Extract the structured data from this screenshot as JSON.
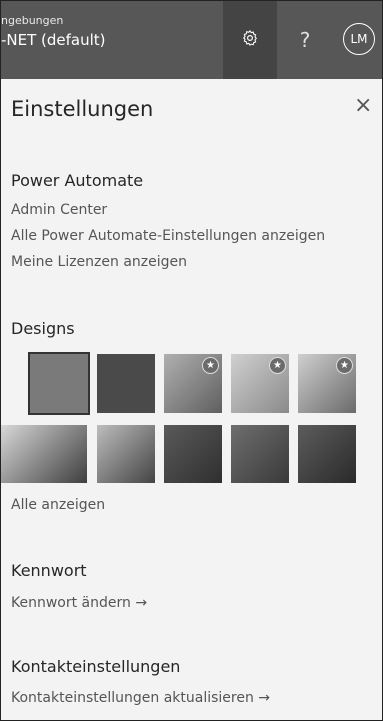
{
  "header": {
    "env_label": "ngebungen",
    "env_name": "-NET (default)",
    "help_glyph": "?",
    "avatar_initials": "LM"
  },
  "panel": {
    "title": "Einstellungen",
    "close_glyph": "×"
  },
  "power_automate": {
    "title": "Power Automate",
    "links": [
      "Admin Center",
      "Alle Power Automate-Einstellungen anzeigen",
      "Meine Lizenzen anzeigen"
    ]
  },
  "designs": {
    "title": "Designs",
    "show_all": "Alle anzeigen",
    "thumbnails": [
      {
        "name": "design-solid-gray",
        "starred": false,
        "colors": [
          "#7a7a7a",
          "#7a7a7a"
        ]
      },
      {
        "name": "design-solid-dark",
        "starred": false,
        "colors": [
          "#4a4a4a",
          "#4a4a4a"
        ]
      },
      {
        "name": "design-waves",
        "starred": true,
        "colors": [
          "#b0b0b0",
          "#5f5f5f"
        ]
      },
      {
        "name": "design-ribbons",
        "starred": true,
        "colors": [
          "#d0d0d0",
          "#8a8a8a"
        ]
      },
      {
        "name": "design-flowers",
        "starred": true,
        "colors": [
          "#cfcfcf",
          "#6a6a6a"
        ]
      },
      {
        "name": "design-hills",
        "starred": false,
        "colors": [
          "#d9d9d9",
          "#3e3e3e"
        ]
      },
      {
        "name": "design-palms",
        "starred": false,
        "colors": [
          "#bdbdbd",
          "#444444"
        ]
      },
      {
        "name": "design-circuit",
        "starred": false,
        "colors": [
          "#5a5a5a",
          "#2f2f2f"
        ]
      },
      {
        "name": "design-aviation",
        "starred": false,
        "colors": [
          "#6e6e6e",
          "#3a3a3a"
        ]
      },
      {
        "name": "design-bokeh",
        "starred": false,
        "colors": [
          "#5c5c5c",
          "#2a2a2a"
        ]
      }
    ]
  },
  "password": {
    "title": "Kennwort",
    "link": "Kennwort ändern →"
  },
  "contact": {
    "title": "Kontakteinstellungen",
    "link": "Kontakteinstellungen aktualisieren →"
  }
}
